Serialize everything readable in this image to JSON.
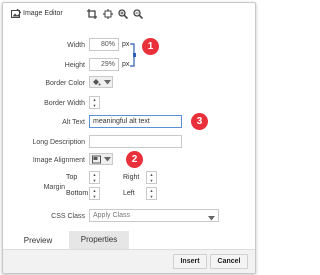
{
  "toolbar": {
    "title": "Image Editor",
    "icons": [
      "image-editor-icon",
      "crop-icon",
      "resize-icon",
      "zoom-in-icon",
      "zoom-out-icon"
    ]
  },
  "fields": {
    "width": {
      "label": "Width",
      "value": "80%",
      "unit": "px"
    },
    "height": {
      "label": "Height",
      "value": "29%",
      "unit": "px"
    },
    "border_color": {
      "label": "Border Color"
    },
    "border_width": {
      "label": "Border Width",
      "value": ""
    },
    "alt_text": {
      "label": "Alt Text",
      "value": "meaningful alt text"
    },
    "long_description": {
      "label": "Long Description",
      "value": ""
    },
    "image_alignment": {
      "label": "Image Alignment"
    },
    "margin": {
      "label": "Margin",
      "top": "Top",
      "right": "Right",
      "bottom": "Bottom",
      "left": "Left"
    },
    "css_class": {
      "label": "CSS Class",
      "placeholder": "Apply Class"
    }
  },
  "tabs": [
    {
      "label": "Preview",
      "active": false
    },
    {
      "label": "Properties",
      "active": true
    }
  ],
  "actions": {
    "insert": "Insert",
    "cancel": "Cancel"
  },
  "annotations": [
    "1",
    "2",
    "3"
  ],
  "colors": {
    "badge": "#e8313a",
    "focus_border": "#5b8fd6",
    "link_bracket": "#2a5fb5"
  }
}
